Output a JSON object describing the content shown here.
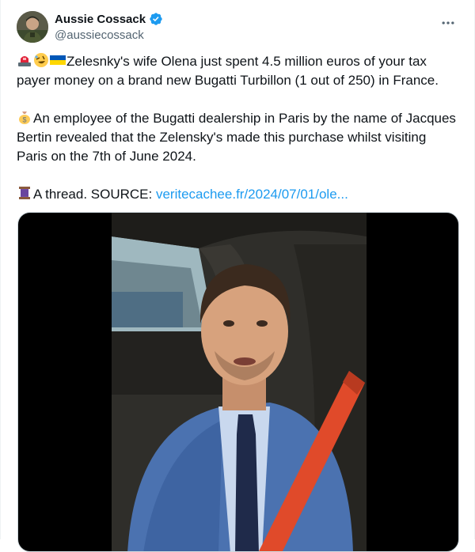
{
  "author": {
    "display_name": "Aussie Cossack",
    "handle": "@aussiecossack",
    "verified": true,
    "avatar_icon": "user-avatar-photo"
  },
  "header": {
    "more_icon": "more-horizontal-icon"
  },
  "tweet": {
    "line1": "Zelesnky's wife Olena just spent 4.5 million euros of your tax payer money on a brand new Bugatti Turbillon (1 out of 250) in France.",
    "line2": "An employee of the Bugatti dealership in Paris by the name of Jacques Bertin revealed that the Zelensky's made this purchase whilst visiting Paris on the 7th of June 2024.",
    "line3_prefix": "A thread. SOURCE: ",
    "link": "veritecachee.fr/2024/07/01/ole..."
  },
  "emojis": {
    "siren": "police-car-light-emoji",
    "laugh": "rolling-on-floor-laughing-emoji",
    "flag": "ukraine-flag-emoji",
    "money": "money-bag-emoji",
    "thread": "spool-of-thread-emoji"
  },
  "media": {
    "type": "video",
    "description_icon": "video-thumbnail"
  },
  "colors": {
    "accent": "#1d9bf0",
    "text": "#0f1419",
    "muted": "#536471"
  }
}
